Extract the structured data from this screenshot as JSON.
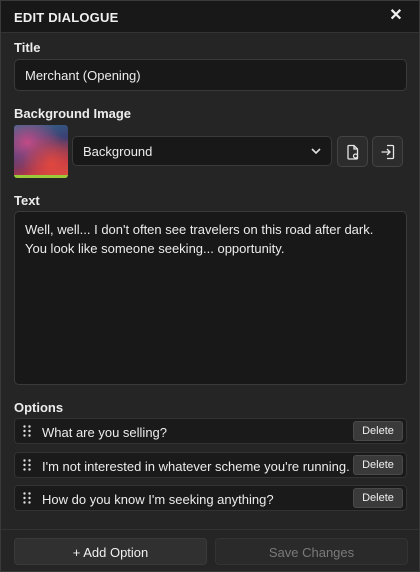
{
  "header": {
    "title": "EDIT DIALOGUE",
    "close_icon": "close-icon"
  },
  "title_section": {
    "label": "Title",
    "value": "Merchant (Opening)"
  },
  "background_section": {
    "label": "Background Image",
    "selected": "Background",
    "thumbnail_colors": [
      "#2a6f8f",
      "#c24a86",
      "#d4553f"
    ],
    "accent": "#9ccb3a",
    "buttons": [
      "file-icon",
      "import-icon"
    ]
  },
  "text_section": {
    "label": "Text",
    "value": "Well, well... I don't often see travelers on this road after dark. You look like someone seeking... opportunity."
  },
  "options_section": {
    "label": "Options",
    "items": [
      {
        "text": "What are you selling?",
        "delete_label": "Delete"
      },
      {
        "text": "I'm not interested in whatever scheme you're running.",
        "delete_label": "Delete"
      },
      {
        "text": "How do you know I'm seeking anything?",
        "delete_label": "Delete"
      }
    ]
  },
  "footer": {
    "add_label": "+ Add Option",
    "save_label": "Save Changes"
  }
}
